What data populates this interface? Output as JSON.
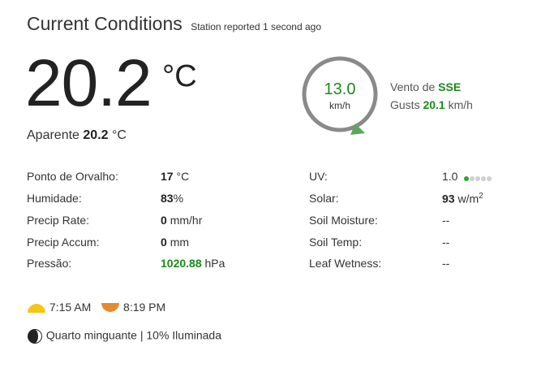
{
  "header": {
    "title": "Current Conditions",
    "subtitle": "Station reported 1 second ago"
  },
  "temperature": {
    "value": "20.2",
    "unit": "°C"
  },
  "feels_like": {
    "label": "Aparente",
    "value": "20.2",
    "unit": "°C"
  },
  "wind": {
    "speed": "13.0",
    "speed_unit": "km/h",
    "direction_label": "Vento de",
    "direction": "SSE",
    "gusts_label": "Gusts",
    "gusts": "20.1",
    "gusts_unit": "km/h",
    "arrow_color": "#5aa85a"
  },
  "left_table": [
    {
      "label": "Ponto de Orvalho:",
      "value": "17",
      "unit": "°C"
    },
    {
      "label": "Humidade:",
      "value": "83",
      "unit": "%"
    },
    {
      "label": "Precip Rate:",
      "value": "0",
      "unit": "mm/hr"
    },
    {
      "label": "Precip Accum:",
      "value": "0",
      "unit": "mm"
    },
    {
      "label": "Pressão:",
      "value": "1020.88",
      "unit": "hPa"
    }
  ],
  "right_table": [
    {
      "label": "UV:",
      "value": "1.0",
      "uv_level": 1,
      "uv_dots": 5
    },
    {
      "label": "Solar:",
      "value": "93",
      "unit": "w/m",
      "unit_sup": "2"
    },
    {
      "label": "Soil Moisture:",
      "value": "--"
    },
    {
      "label": "Soil Temp:",
      "value": "--"
    },
    {
      "label": "Leaf Wetness:",
      "value": "--"
    }
  ],
  "astro": {
    "sunrise": "7:15 AM",
    "sunset": "8:19 PM",
    "moon_phase": "Quarto minguante | 10% Iluminada",
    "sunrise_color": "#f5c518",
    "sunset_color": "#e8892e"
  },
  "colors": {
    "accent_green": "#1b8a1b",
    "text": "#333333"
  }
}
